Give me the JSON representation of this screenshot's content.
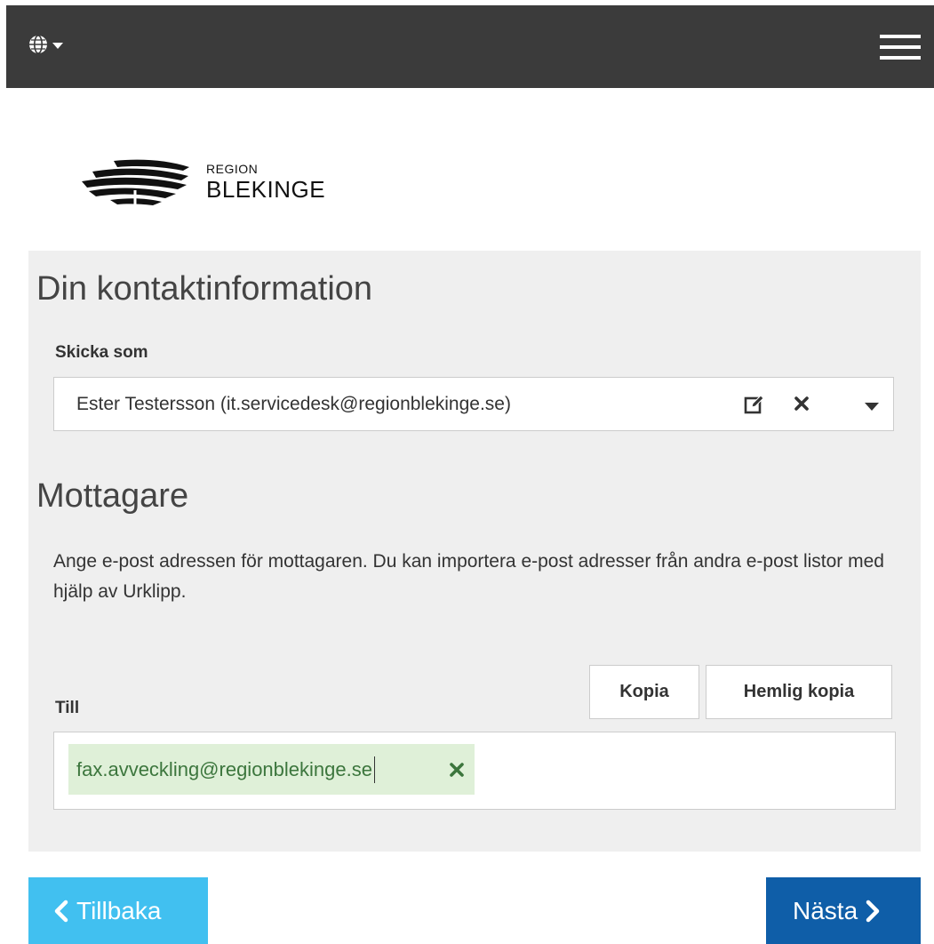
{
  "topbar": {
    "language_icon": "globe-icon",
    "language_caret_icon": "caret-down-icon",
    "menu_icon": "hamburger-menu-icon"
  },
  "logo": {
    "line1": "REGION",
    "line2": "BLEKINGE"
  },
  "contact": {
    "heading": "Din kontaktinformation",
    "send_as_label": "Skicka som",
    "send_as_value": "Ester Testersson (it.servicedesk@regionblekinge.se)",
    "icons": [
      "edit-icon",
      "clear-icon",
      "caret-down-icon"
    ]
  },
  "recipients": {
    "heading": "Mottagare",
    "description": "Ange e-post adressen för mottagaren. Du kan importera e-post adresser från andra e-post listor med hjälp av Urklipp.",
    "cc_button": "Kopia",
    "bcc_button": "Hemlig kopia",
    "to_label": "Till",
    "to_chips": [
      "fax.avveckling@regionblekinge.se"
    ]
  },
  "nav": {
    "back_label": "Tillbaka",
    "next_label": "Nästa"
  },
  "colors": {
    "topbar": "#3b3b3b",
    "panel": "#efefef",
    "chip_bg": "#dff0d8",
    "chip_text": "#3c763d",
    "back_button": "#41c0f0",
    "next_button": "#0f5ea8"
  }
}
